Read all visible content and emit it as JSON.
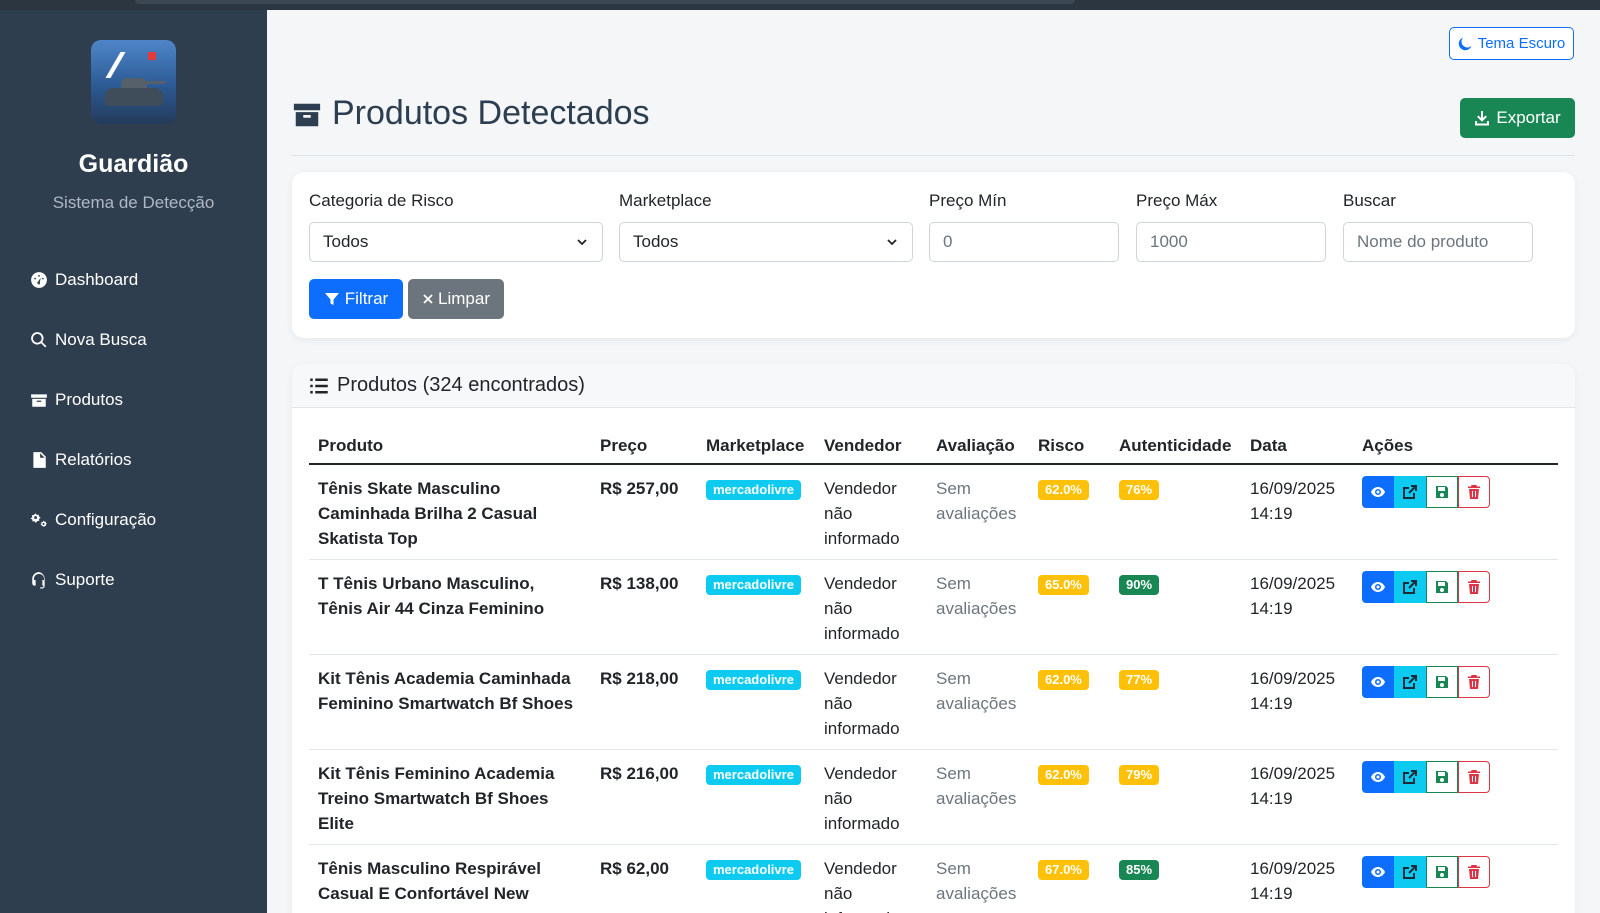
{
  "sidebar": {
    "brand": "Guardião",
    "subtitle": "Sistema de Detecção",
    "items": [
      {
        "label": "Dashboard",
        "icon": "dashboard-icon"
      },
      {
        "label": "Nova Busca",
        "icon": "search-icon"
      },
      {
        "label": "Produtos",
        "icon": "box-icon"
      },
      {
        "label": "Relatórios",
        "icon": "report-icon"
      },
      {
        "label": "Configuração",
        "icon": "gears-icon"
      },
      {
        "label": "Suporte",
        "icon": "headset-icon"
      }
    ]
  },
  "header": {
    "theme_label": "Tema Escuro",
    "title": "Produtos Detectados",
    "export_label": "Exportar"
  },
  "filters": {
    "risk_label": "Categoria de Risco",
    "risk_value": "Todos",
    "marketplace_label": "Marketplace",
    "marketplace_value": "Todos",
    "price_min_label": "Preço Mín",
    "price_min_placeholder": "0",
    "price_max_label": "Preço Máx",
    "price_max_placeholder": "1000",
    "search_label": "Buscar",
    "search_placeholder": "Nome do produto",
    "filter_button": "Filtrar",
    "clear_button": "Limpar"
  },
  "products": {
    "header": "Produtos (324 encontrados)",
    "columns": [
      "Produto",
      "Preço",
      "Marketplace",
      "Vendedor",
      "Avaliação",
      "Risco",
      "Autenticidade",
      "Data",
      "Ações"
    ],
    "rows": [
      {
        "name": "Tênis Skate Masculino Caminhada Brilha 2 Casual Skatista Top",
        "price": "R$ 257,00",
        "marketplace": "mercadolivre",
        "seller": "Vendedor não informado",
        "rating": "Sem avaliações",
        "risk": "62.0%",
        "auth": "76%",
        "auth_level": "warn",
        "date": "16/09/2025 14:19"
      },
      {
        "name": "T Tênis Urbano Masculino, Tênis Air 44 Cinza Feminino",
        "price": "R$ 138,00",
        "marketplace": "mercadolivre",
        "seller": "Vendedor não informado",
        "rating": "Sem avaliações",
        "risk": "65.0%",
        "auth": "90%",
        "auth_level": "ok",
        "date": "16/09/2025 14:19"
      },
      {
        "name": "Kit Tênis Academia Caminhada Feminino Smartwatch Bf Shoes",
        "price": "R$ 218,00",
        "marketplace": "mercadolivre",
        "seller": "Vendedor não informado",
        "rating": "Sem avaliações",
        "risk": "62.0%",
        "auth": "77%",
        "auth_level": "warn",
        "date": "16/09/2025 14:19"
      },
      {
        "name": "Kit Tênis Feminino Academia Treino Smartwatch Bf Shoes Elite",
        "price": "R$ 216,00",
        "marketplace": "mercadolivre",
        "seller": "Vendedor não informado",
        "rating": "Sem avaliações",
        "risk": "62.0%",
        "auth": "79%",
        "auth_level": "warn",
        "date": "16/09/2025 14:19"
      },
      {
        "name": "Tênis Masculino Respirável Casual E Confortável New",
        "price": "R$ 62,00",
        "marketplace": "mercadolivre",
        "seller": "Vendedor não informado",
        "rating": "Sem avaliações",
        "risk": "67.0%",
        "auth": "85%",
        "auth_level": "ok",
        "date": "16/09/2025 14:19"
      }
    ]
  },
  "colors": {
    "sidebar_bg": "#2f3e4f",
    "primary": "#0d6efd",
    "success": "#198754",
    "info": "#0dcaf0",
    "warning": "#ffc107",
    "danger": "#dc3545"
  }
}
